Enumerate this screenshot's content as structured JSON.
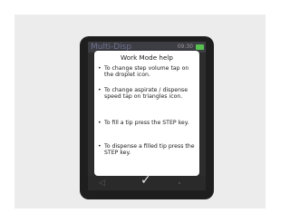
{
  "device": {
    "app_title": "Multi-Disp",
    "clock": "09:30",
    "battery_color": "#56c14f"
  },
  "help": {
    "title": "Work Mode help",
    "bullet": "•",
    "items": [
      "To change step volume tap on the droplet icon.",
      "To change aspirate / dispense speed tap on triangles icon.",
      "To fill a tip press the STEP key.",
      "To dispense a filled tip press the STEP key."
    ]
  },
  "footer": {
    "confirm_glyph": "✓"
  }
}
